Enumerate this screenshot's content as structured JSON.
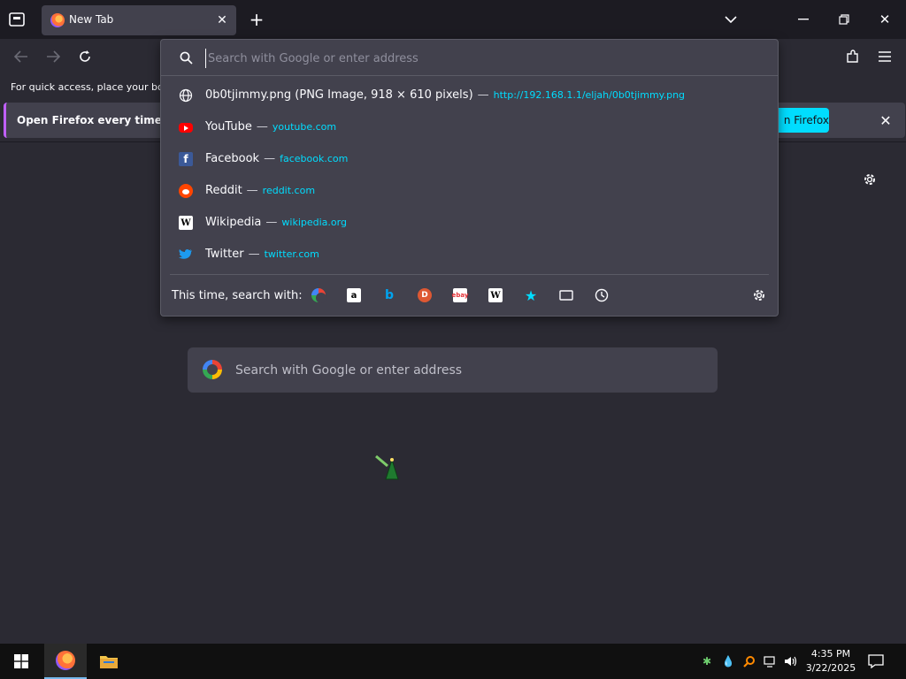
{
  "tab": {
    "title": "New Tab"
  },
  "url_panel": {
    "placeholder": "Search with Google or enter address",
    "results": [
      {
        "icon": "globe-icon",
        "title": "0b0tjimmy.png (PNG Image, 918 × 610 pixels)",
        "sep": "—",
        "url": "http://192.168.1.1/eljah/0b0tjimmy.png"
      },
      {
        "icon": "youtube-icon",
        "title": "YouTube",
        "sep": "—",
        "url": "youtube.com"
      },
      {
        "icon": "facebook-icon",
        "title": "Facebook",
        "sep": "—",
        "url": "facebook.com"
      },
      {
        "icon": "reddit-icon",
        "title": "Reddit",
        "sep": "—",
        "url": "reddit.com"
      },
      {
        "icon": "wikipedia-icon",
        "title": "Wikipedia",
        "sep": "—",
        "url": "wikipedia.org"
      },
      {
        "icon": "twitter-icon",
        "title": "Twitter",
        "sep": "—",
        "url": "twitter.com"
      }
    ],
    "oneoff_label": "This time, search with:",
    "engines": [
      "google-icon",
      "amazon-icon",
      "bing-icon",
      "duckduckgo-icon",
      "ebay-icon",
      "wikipedia-icon",
      "bookmarks-icon",
      "tabs-icon",
      "history-icon"
    ]
  },
  "bookmarks_bar": {
    "text": "For quick access, place your boo"
  },
  "banner": {
    "text": "Open Firefox every time you",
    "button": "n Firefox"
  },
  "newtab_search": {
    "placeholder": "Search with Google or enter address"
  },
  "clock": {
    "time": "4:35 PM",
    "date": "3/22/2025"
  },
  "colors": {
    "accent": "#00ddff",
    "banner_stripe": "#c060ff",
    "background": "#2b2a33"
  }
}
